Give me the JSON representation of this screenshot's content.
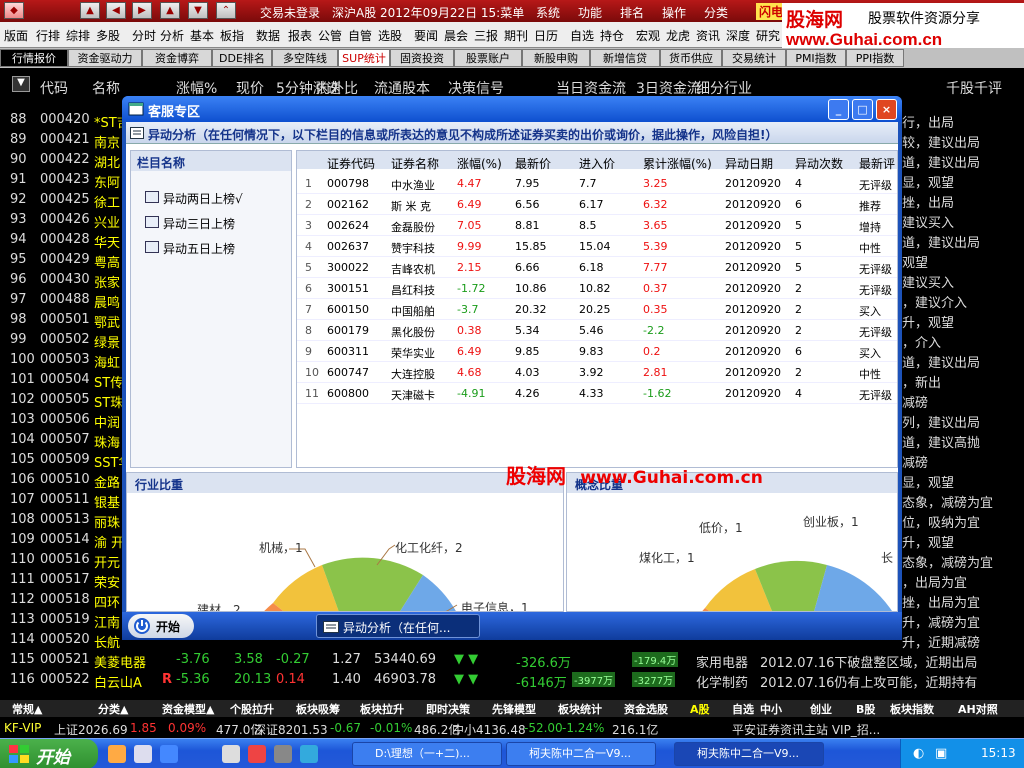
{
  "titlebar": {
    "buttons": [
      "▲",
      "◀",
      "▶",
      "▲",
      "▼",
      "⌃"
    ],
    "items": [
      "交易未登录",
      "深沪A股 2012年09月22日 15:菜单",
      "系统",
      "功能",
      "排名",
      "操作",
      "分类"
    ],
    "flash": "闪电手"
  },
  "logo": {
    "brand": "股海网",
    "slogan": "股票软件资源分享",
    "url": "www.Guhai.com.cn"
  },
  "menubar": [
    "版面",
    "行排",
    "综排",
    "多股",
    "分时",
    "分析",
    "基本",
    "板指",
    "数据",
    "报表",
    "公管",
    "自管",
    "选股",
    "要闻",
    "晨会",
    "三报",
    "期刊",
    "日历",
    "自选",
    "持仓",
    "宏观",
    "龙虎",
    "资讯",
    "深度",
    "研究",
    "缘"
  ],
  "tabs": [
    "行情报价",
    "资金驱动力",
    "资金博弈",
    "DDE排名",
    "多空阵线",
    "SUP统计",
    "固资投资",
    "股票账户",
    "新股申购",
    "新增信贷",
    "货币供应",
    "交易统计",
    "PMI指数",
    "PPI指数"
  ],
  "header": [
    "代码",
    "名称",
    "涨幅%",
    "现价",
    "5分钟涨速",
    "内外比",
    "流通股本",
    "决策信号",
    "当日资金流",
    "3日资金流",
    "细分行业",
    "千股千评"
  ],
  "rows": [
    {
      "n": "88",
      "code": "000420",
      "name": "*ST吉",
      "tail": "行，出局"
    },
    {
      "n": "89",
      "code": "000421",
      "name": "南京",
      "tail": "较，建议出局"
    },
    {
      "n": "90",
      "code": "000422",
      "name": "湖北",
      "tail": "道，建议出局"
    },
    {
      "n": "91",
      "code": "000423",
      "name": "东阿",
      "tail": "显，观望"
    },
    {
      "n": "92",
      "code": "000425",
      "name": "徐工",
      "tail": "挫，出局"
    },
    {
      "n": "93",
      "code": "000426",
      "name": "兴业",
      "tail": "建议买入"
    },
    {
      "n": "94",
      "code": "000428",
      "name": "华天",
      "tail": "道，建议出局"
    },
    {
      "n": "95",
      "code": "000429",
      "name": "粤高",
      "tail": "观望"
    },
    {
      "n": "96",
      "code": "000430",
      "name": "张家",
      "tail": "建议买入"
    },
    {
      "n": "97",
      "code": "000488",
      "name": "晨鸣",
      "tail": "，建议介入"
    },
    {
      "n": "98",
      "code": "000501",
      "name": "鄂武",
      "tail": "升，观望"
    },
    {
      "n": "99",
      "code": "000502",
      "name": "绿景",
      "tail": "，介入"
    },
    {
      "n": "100",
      "code": "000503",
      "name": "海虹",
      "tail": "道，建议出局"
    },
    {
      "n": "101",
      "code": "000504",
      "name": "ST传",
      "tail": "，新出"
    },
    {
      "n": "102",
      "code": "000505",
      "name": "ST珠",
      "tail": "减磅"
    },
    {
      "n": "103",
      "code": "000506",
      "name": "中润",
      "tail": "列，建议出局"
    },
    {
      "n": "104",
      "code": "000507",
      "name": "珠海",
      "tail": "道，建议高抛"
    },
    {
      "n": "105",
      "code": "000509",
      "name": "SST华",
      "tail": "减磅"
    },
    {
      "n": "106",
      "code": "000510",
      "name": "金路",
      "tail": "显，观望"
    },
    {
      "n": "107",
      "code": "000511",
      "name": "银基",
      "tail": "态象，减磅为宜"
    },
    {
      "n": "108",
      "code": "000513",
      "name": "丽珠",
      "tail": "位，吸纳为宜"
    },
    {
      "n": "109",
      "code": "000514",
      "name": "渝 开",
      "tail": "升，观望"
    },
    {
      "n": "110",
      "code": "000516",
      "name": "开元",
      "tail": "态象，减磅为宜"
    },
    {
      "n": "111",
      "code": "000517",
      "name": "荣安",
      "tail": "，出局为宜"
    },
    {
      "n": "112",
      "code": "000518",
      "name": "四环",
      "tail": "挫，出局为宜"
    },
    {
      "n": "113",
      "code": "000519",
      "name": "江南",
      "tail": "升，减磅为宜"
    },
    {
      "n": "114",
      "code": "000520",
      "name": "长航",
      "tail": "升，近期减磅"
    }
  ],
  "fullrows": [
    {
      "n": "115",
      "code": "000521",
      "name": "美菱电器",
      "chg": "-3.76",
      "price": "3.58",
      "speed": "-0.27",
      "ratio": "1.27",
      "shares": "53440.69",
      "flow": "-326.6万",
      "flow3": "-179.4万",
      "ind": "家用电器",
      "comment": "2012.07.16下破盘整区域，近期出局"
    },
    {
      "n": "116",
      "code": "000522",
      "name": "白云山A",
      "flag": "R",
      "chg": "-5.36",
      "price": "20.13",
      "speed": "0.14",
      "ratio": "1.40",
      "shares": "46903.78",
      "flow": "-6146万",
      "flow1": "-3977万",
      "flow3": "-3277万",
      "ind": "化学制药",
      "comment": "2012.07.16仍有上攻可能，近期持有"
    }
  ],
  "bottomtabs": [
    "常规▲",
    "分类▲",
    "资金模型▲",
    "个股拉升",
    "板块吸筹",
    "板块拉升",
    "即时决策",
    "先锋模型",
    "板块统计",
    "资金选股",
    "A股",
    "自选",
    "中小",
    "创业",
    "B股",
    "板块指数",
    "AH对照"
  ],
  "indexbar": [
    {
      "t": "KF-VIP",
      "c": "#ff3"
    },
    {
      "t": "上证2026.69",
      "c": "#ddd"
    },
    {
      "t": "1.85",
      "c": "#f33"
    },
    {
      "t": "0.09%",
      "c": "#f33"
    },
    {
      "t": "477.0亿",
      "c": "#ddd"
    },
    {
      "t": "深证8201.53",
      "c": "#ddd"
    },
    {
      "t": "-0.67",
      "c": "#3c3"
    },
    {
      "t": "-0.01%",
      "c": "#3c3"
    },
    {
      "t": "486.2亿",
      "c": "#ddd"
    },
    {
      "t": "中小4136.48",
      "c": "#ddd"
    },
    {
      "t": "-52.00",
      "c": "#3c3"
    },
    {
      "t": "-1.24%",
      "c": "#3c3"
    },
    {
      "t": "216.1亿",
      "c": "#ddd"
    },
    {
      "t": "平安证券资讯主站 VIP_招...",
      "c": "#ddd"
    }
  ],
  "dialog": {
    "title": "客服专区",
    "warning": "异动分析（在任何情况下，以下栏目的信息或所表达的意见不构成所述证券买卖的出价或询价，据此操作，风险自担!）",
    "left": {
      "title": "栏目名称",
      "items": [
        "异动两日上榜√",
        "异动三日上榜",
        "异动五日上榜"
      ]
    },
    "grid": {
      "cols": [
        "证券代码",
        "证券名称",
        "涨幅(%)",
        "最新价",
        "进入价",
        "累计涨幅(%)",
        "异动日期",
        "异动次数",
        "最新评"
      ],
      "rows": [
        {
          "i": "1",
          "code": "000798",
          "name": "中水渔业",
          "chg": "4.47",
          "last": "7.95",
          "in": "7.7",
          "cum": "3.25",
          "date": "20120920",
          "cnt": "4",
          "rate": "无评级"
        },
        {
          "i": "2",
          "code": "002162",
          "name": "斯 米 克",
          "chg": "6.49",
          "last": "6.56",
          "in": "6.17",
          "cum": "6.32",
          "date": "20120920",
          "cnt": "6",
          "rate": "推荐"
        },
        {
          "i": "3",
          "code": "002624",
          "name": "金磊股份",
          "chg": "7.05",
          "last": "8.81",
          "in": "8.5",
          "cum": "3.65",
          "date": "20120920",
          "cnt": "5",
          "rate": "增持"
        },
        {
          "i": "4",
          "code": "002637",
          "name": "赞宇科技",
          "chg": "9.99",
          "last": "15.85",
          "in": "15.04",
          "cum": "5.39",
          "date": "20120920",
          "cnt": "5",
          "rate": "中性"
        },
        {
          "i": "5",
          "code": "300022",
          "name": "吉峰农机",
          "chg": "2.15",
          "last": "6.66",
          "in": "6.18",
          "cum": "7.77",
          "date": "20120920",
          "cnt": "5",
          "rate": "无评级"
        },
        {
          "i": "6",
          "code": "300151",
          "name": "昌红科技",
          "chg": "-1.72",
          "last": "10.86",
          "in": "10.82",
          "cum": "0.37",
          "date": "20120920",
          "cnt": "2",
          "rate": "无评级"
        },
        {
          "i": "7",
          "code": "600150",
          "name": "中国船舶",
          "chg": "-3.7",
          "last": "20.32",
          "in": "20.25",
          "cum": "0.35",
          "date": "20120920",
          "cnt": "2",
          "rate": "买入"
        },
        {
          "i": "8",
          "code": "600179",
          "name": "黑化股份",
          "chg": "0.38",
          "last": "5.34",
          "in": "5.46",
          "cum": "-2.2",
          "date": "20120920",
          "cnt": "2",
          "rate": "无评级"
        },
        {
          "i": "9",
          "code": "600311",
          "name": "荣华实业",
          "chg": "6.49",
          "last": "9.85",
          "in": "9.83",
          "cum": "0.2",
          "date": "20120920",
          "cnt": "6",
          "rate": "买入"
        },
        {
          "i": "10",
          "code": "600747",
          "name": "大连控股",
          "chg": "4.68",
          "last": "4.03",
          "in": "3.92",
          "cum": "2.81",
          "date": "20120920",
          "cnt": "2",
          "rate": "中性"
        },
        {
          "i": "11",
          "code": "600800",
          "name": "天津磁卡",
          "chg": "-4.91",
          "last": "4.26",
          "in": "4.33",
          "cum": "-1.62",
          "date": "20120920",
          "cnt": "4",
          "rate": "无评级"
        }
      ]
    },
    "industry": {
      "title": "行业比重",
      "labels": [
        "机械，1",
        "化工化纤，2",
        "建材，2",
        "电子信息，1"
      ]
    },
    "concept": {
      "title": "概念比重",
      "labels": [
        "低价，1",
        "创业板，1",
        "煤化工，1",
        "长"
      ]
    },
    "start": "开始",
    "task": "异动分析（在任何..."
  },
  "watermark": {
    "a": "股海网",
    "b": "www.Guhai.com.cn"
  },
  "taskbar": {
    "start": "开始",
    "items": [
      "D:\\理想（一+二)...",
      "柯夫陈中二合一V9...",
      "柯夫陈中二合一V9..."
    ],
    "time": "15:13"
  }
}
